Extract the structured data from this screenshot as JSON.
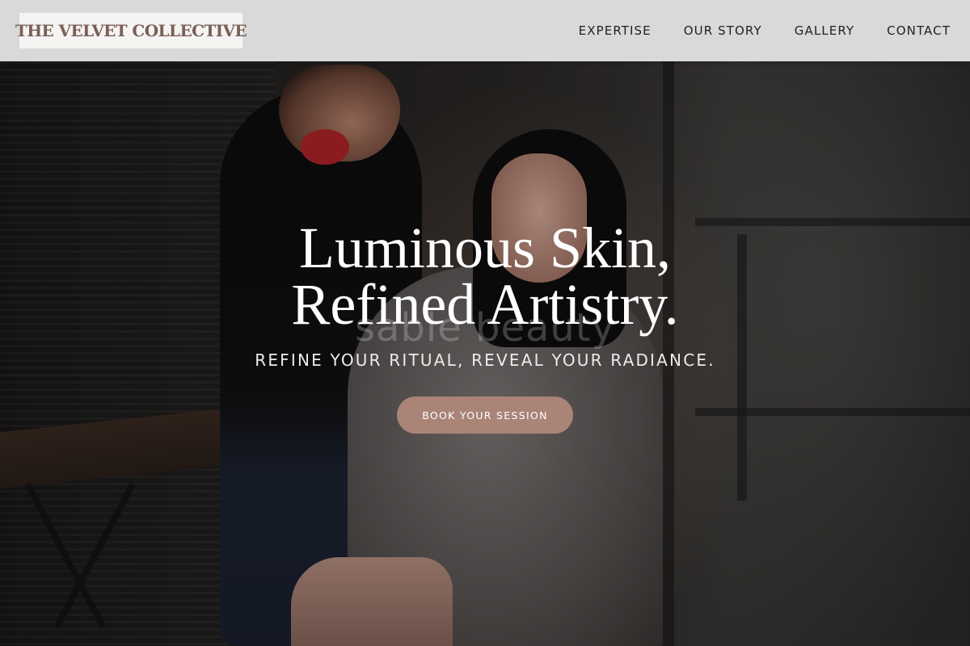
{
  "header": {
    "logo": "THE VELVET COLLECTIVE",
    "nav": [
      "EXPERTISE",
      "OUR STORY",
      "GALLERY",
      "CONTACT"
    ]
  },
  "hero": {
    "headline_line1": "Luminous Skin,",
    "headline_line2": "Refined Artistry.",
    "watermark": "sable beauty",
    "subheadline": "REFINE YOUR RITUAL, REVEAL YOUR RADIANCE.",
    "cta_label": "BOOK YOUR SESSION"
  },
  "colors": {
    "header_bg": "#d9d9d9",
    "logo_text": "#7a5f58",
    "cta_bg": "#a98477"
  }
}
